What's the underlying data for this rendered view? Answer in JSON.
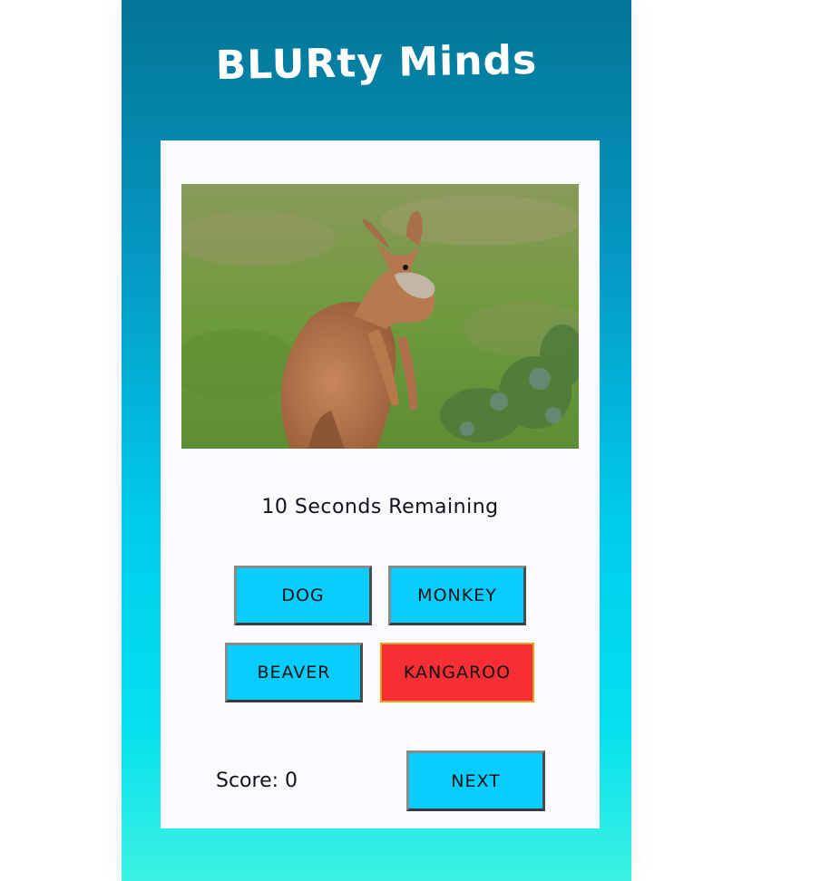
{
  "app": {
    "title": "BLURty Minds"
  },
  "quiz": {
    "image_subject": "kangaroo",
    "timer_text": "10 Seconds Remaining",
    "choices": [
      {
        "label": "DOG",
        "selected": false
      },
      {
        "label": "MONKEY",
        "selected": false
      },
      {
        "label": "BEAVER",
        "selected": false
      },
      {
        "label": "KANGAROO",
        "selected": true
      }
    ],
    "score_text": "Score: 0",
    "next_label": "NEXT"
  },
  "colors": {
    "choice_default": "#06cdfd",
    "choice_selected": "#f72f35",
    "selected_border": "#e7a01c"
  }
}
